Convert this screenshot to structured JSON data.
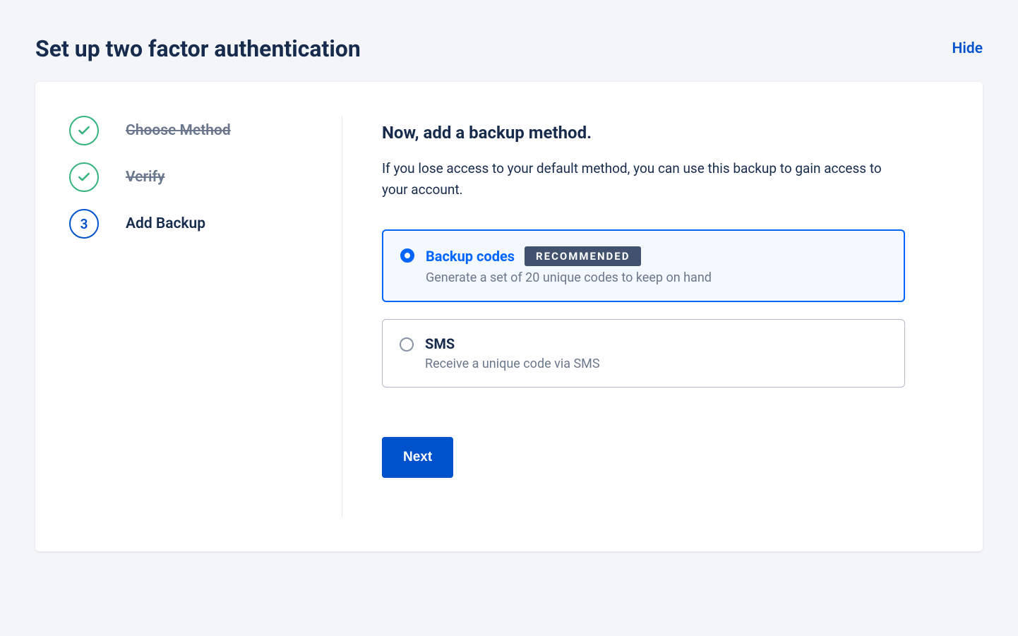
{
  "header": {
    "title": "Set up two factor authentication",
    "hide_label": "Hide"
  },
  "steps": [
    {
      "label": "Choose Method",
      "status": "done"
    },
    {
      "label": "Verify",
      "status": "done"
    },
    {
      "label": "Add Backup",
      "status": "active",
      "number": "3"
    }
  ],
  "content": {
    "heading": "Now, add a backup method.",
    "subtext": "If you lose access to your default method, you can use this backup to gain access to your account."
  },
  "options": [
    {
      "id": "backup-codes",
      "title": "Backup codes",
      "badge": "RECOMMENDED",
      "description": "Generate a set of 20 unique codes to keep on hand",
      "selected": true
    },
    {
      "id": "sms",
      "title": "SMS",
      "description": "Receive a unique code via SMS",
      "selected": false
    }
  ],
  "actions": {
    "next_label": "Next"
  }
}
